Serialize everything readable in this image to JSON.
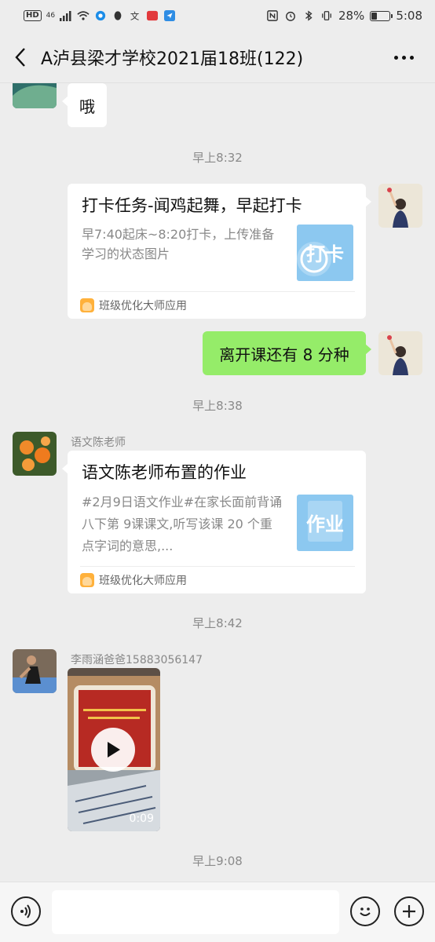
{
  "status_bar": {
    "hd": "HD",
    "signal_label": "46",
    "battery_percent": "28%",
    "battery_level": 0.28,
    "time": "5:08"
  },
  "nav": {
    "title": "A泸县梁才学校2021届18班(122)"
  },
  "messages": {
    "m1": {
      "text": "哦"
    },
    "ts1": "早上8:32",
    "card1": {
      "title": "打卡任务-闻鸡起舞，早起打卡",
      "description": "早7:40起床~8:20打卡，上传准备学习的状态图片",
      "thumb_text": "打卡",
      "source": "班级优化大师应用"
    },
    "m2": {
      "text": "离开课还有 8 分种"
    },
    "ts2": "早上8:38",
    "sender_chen": "语文陈老师",
    "card2": {
      "title": "语文陈老师布置的作业",
      "description": "#2月9日语文作业#在家长面前背诵八下第 9课课文,听写该课 20 个重点字词的意思,...",
      "thumb_text": "作业",
      "source": "班级优化大师应用"
    },
    "ts3": "早上8:42",
    "sender_li": "李雨涵爸爸15883056147",
    "video": {
      "duration": "0:09"
    },
    "ts4": "早上9:08"
  },
  "colors": {
    "background": "#ededed",
    "self_bubble": "#95ec69",
    "other_bubble": "#ffffff",
    "thumb_blue": "#8cc8f0"
  },
  "icons": {
    "back": "chevron-left-icon",
    "more": "more-icon",
    "voice": "voice-icon",
    "emoji": "emoji-icon",
    "add": "plus-icon",
    "play": "play-icon"
  }
}
